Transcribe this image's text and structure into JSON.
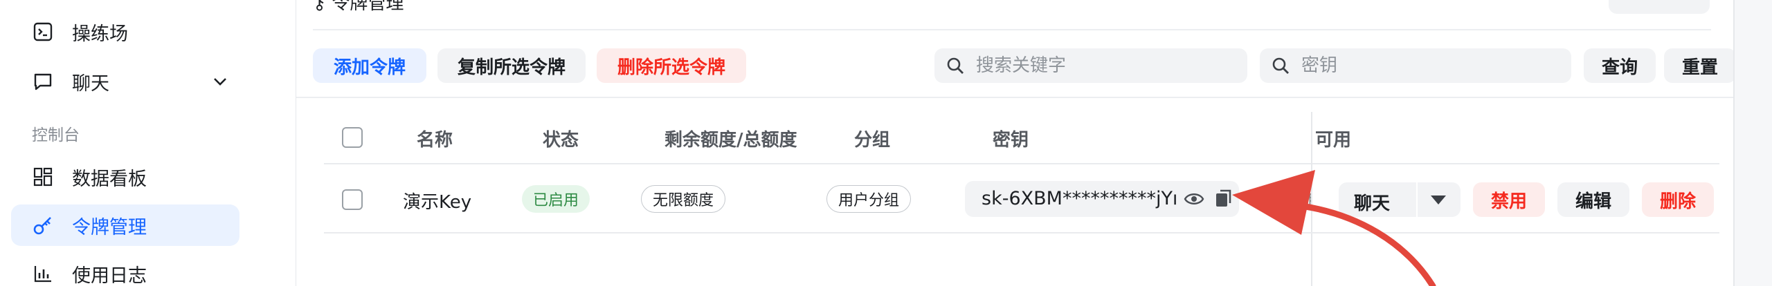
{
  "sidebar": {
    "items_top": [
      {
        "label": "操练场",
        "icon": "terminal-icon"
      },
      {
        "label": "聊天",
        "icon": "chat-bubble-icon"
      }
    ],
    "section_label": "控制台",
    "items_console": [
      {
        "label": "数据看板",
        "icon": "dashboard-grid-icon"
      },
      {
        "label": "令牌管理",
        "icon": "key-icon",
        "active": true
      },
      {
        "label": "使用日志",
        "icon": "bar-chart-icon"
      }
    ]
  },
  "header": {
    "title_partial": "令牌管理"
  },
  "toolbar": {
    "add_label": "添加令牌",
    "copy_label": "复制所选令牌",
    "delete_label": "删除所选令牌",
    "search_placeholder": "搜索关键字",
    "key_placeholder": "密钥",
    "query_label": "查询",
    "reset_label": "重置"
  },
  "table": {
    "columns": [
      "名称",
      "状态",
      "剩余额度/总额度",
      "分组",
      "密钥",
      "可用"
    ],
    "rows": [
      {
        "name": "演示Key",
        "status": "已启用",
        "quota": "无限额度",
        "group": "用户分组",
        "key": "sk-6XBM**********jYı",
        "available_partial": "限",
        "actions": {
          "chat": "聊天",
          "disable": "禁用",
          "edit": "编辑",
          "delete": "删除"
        }
      }
    ]
  },
  "colors": {
    "accent": "#1664ff",
    "danger": "#f52a1f",
    "success": "#2e8b44",
    "annotation_arrow": "#e3473c"
  }
}
